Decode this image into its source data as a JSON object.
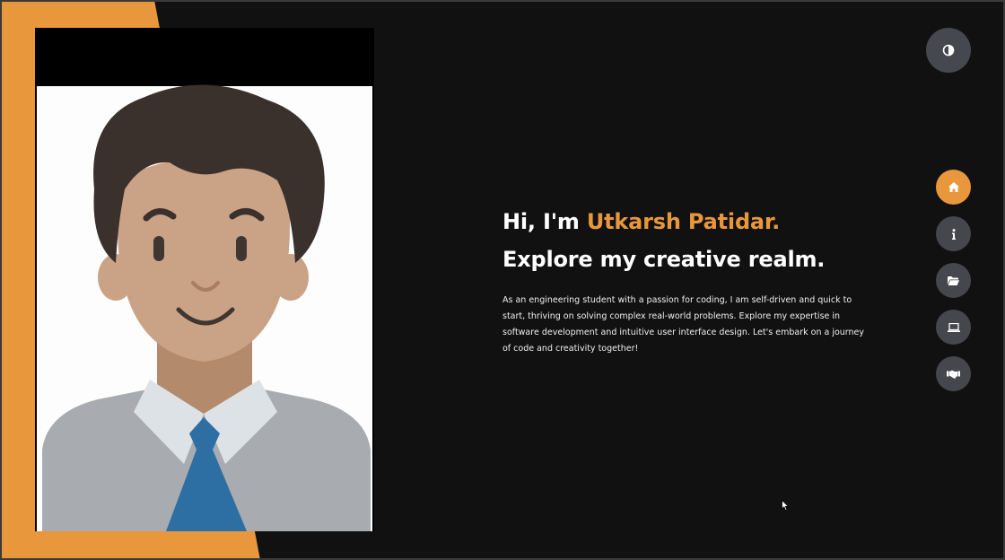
{
  "colors": {
    "accent": "#e8973c",
    "background": "#111111",
    "button": "#45474d",
    "text": "#ffffff"
  },
  "hero": {
    "greeting_prefix": "Hi, I'm ",
    "name": "Utkarsh Patidar.",
    "tagline": "Explore my creative realm.",
    "description": "As an engineering student with a passion for coding, I am self-driven and quick to start, thriving on solving complex real-world problems. Explore my expertise in software development and intuitive user interface design. Let's embark on a journey of code and creativity together!"
  },
  "theme_toggle": {
    "icon": "contrast-icon"
  },
  "nav": {
    "items": [
      {
        "id": "home",
        "icon": "home-icon",
        "active": true
      },
      {
        "id": "about",
        "icon": "info-icon",
        "active": false
      },
      {
        "id": "portfolio",
        "icon": "folder-icon",
        "active": false
      },
      {
        "id": "projects",
        "icon": "laptop-icon",
        "active": false
      },
      {
        "id": "contact",
        "icon": "handshake-icon",
        "active": false
      }
    ]
  },
  "portrait": {
    "icon": "avatar-illustration"
  }
}
